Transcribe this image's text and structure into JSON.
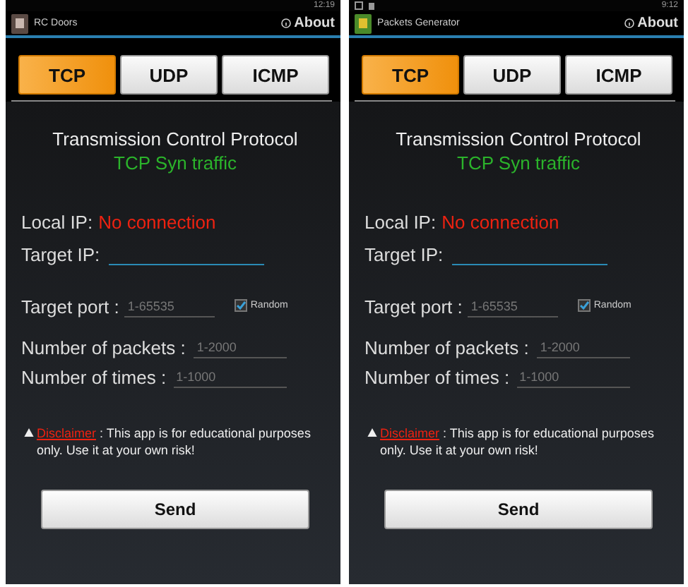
{
  "phones": [
    {
      "status_time": "12:19",
      "status_icons": false,
      "app_title": "RC Doors",
      "about": "About",
      "tabs": [
        {
          "label": "TCP",
          "selected": true
        },
        {
          "label": "UDP",
          "selected": false
        },
        {
          "label": "ICMP",
          "selected": false
        }
      ],
      "heading": "Transmission Control Protocol",
      "subheading": "TCP Syn traffic",
      "local_ip_label": "Local IP:",
      "local_ip_value": "No connection",
      "target_ip_label": "Target IP:",
      "target_port_label": "Target port :",
      "port_placeholder": "1-65535",
      "random": {
        "label": "Random",
        "checked": true
      },
      "packets_label": "Number of packets :",
      "packets_placeholder": "1-2000",
      "times_label": "Number of times :",
      "times_placeholder": "1-1000",
      "disclaimer_link": "Disclaimer",
      "disclaimer_text": " : This app is for educational purposes only. Use it at your own risk!",
      "send": "Send"
    },
    {
      "status_time": "9:12",
      "status_icons": true,
      "app_title": "Packets Generator",
      "about": "About",
      "tabs": [
        {
          "label": "TCP",
          "selected": true
        },
        {
          "label": "UDP",
          "selected": false
        },
        {
          "label": "ICMP",
          "selected": false
        }
      ],
      "heading": "Transmission Control Protocol",
      "subheading": "TCP Syn traffic",
      "local_ip_label": "Local IP:",
      "local_ip_value": "No connection",
      "target_ip_label": "Target IP:",
      "target_port_label": "Target port :",
      "port_placeholder": "1-65535",
      "random": {
        "label": "Random",
        "checked": true
      },
      "packets_label": "Number of packets :",
      "packets_placeholder": "1-2000",
      "times_label": "Number of times :",
      "times_placeholder": "1-1000",
      "disclaimer_link": "Disclaimer",
      "disclaimer_text": " : This app is for educational purposes only. Use it at your own risk!",
      "send": "Send"
    }
  ]
}
